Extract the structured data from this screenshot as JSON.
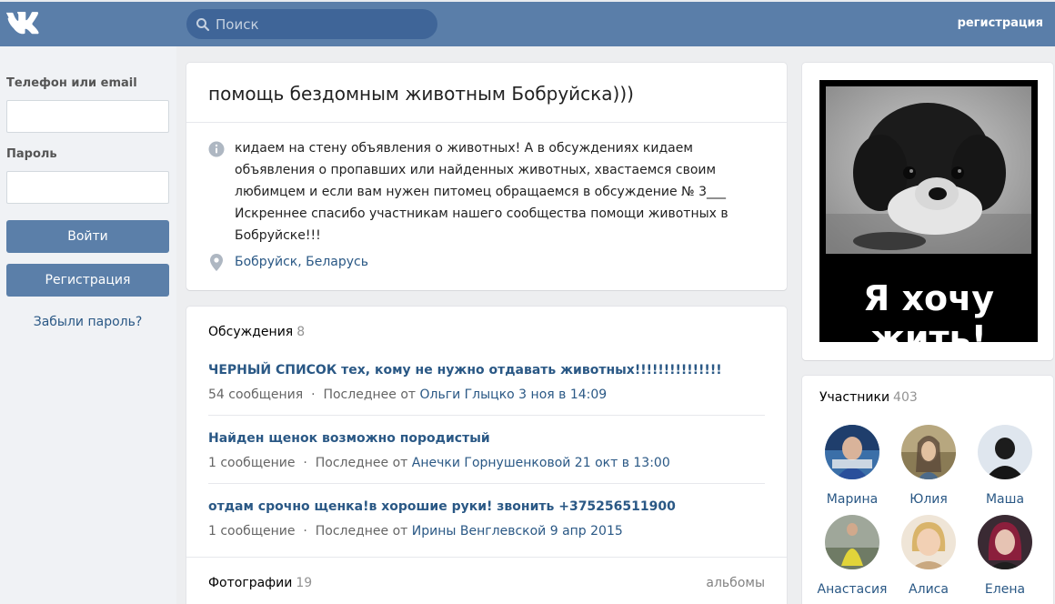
{
  "header": {
    "search_placeholder": "Поиск",
    "register_link": "регистрация",
    "colors": {
      "bar": "#5a7ea9",
      "search_bg": "#3f6598"
    }
  },
  "login": {
    "phone_label": "Телефон или email",
    "phone_value": "",
    "password_label": "Пароль",
    "password_value": "",
    "login_button": "Войти",
    "register_button": "Регистрация",
    "forgot_link": "Забыли пароль?"
  },
  "group": {
    "title": "помощь бездомным животным Бобруйска)))",
    "description": "кидаем на стену объявления о животных! А в обсуждениях кидаем объявления о пропавших или найденных животных, хвастаемся своим любимцем и если вам нужен питомец обращаемся в обсуждение № 3___ Искреннее спасибо участникам нашего сообщества помощи животных в Бобруйске!!!",
    "location": "Бобруйск, Беларусь"
  },
  "discussions": {
    "title": "Обсуждения",
    "count": "8",
    "topics": [
      {
        "title": "ЧЕРНЫЙ СПИСОК тех, кому не нужно отдавать животных!!!!!!!!!!!!!!!",
        "posts": "54 сообщения",
        "sep": "·",
        "last_prefix": "Последнее от",
        "last_author_date": "Ольги Глыцко 3 ноя в 14:09"
      },
      {
        "title": "Найден щенок возможно породистый",
        "posts": "1 сообщение",
        "sep": "·",
        "last_prefix": "Последнее от",
        "last_author_date": "Анечки Горнушенковой 21 окт в 13:00"
      },
      {
        "title": "отдам срочно щенка!в хорошие руки! звонить +375256511900",
        "posts": "1 сообщение",
        "sep": "·",
        "last_prefix": "Последнее от",
        "last_author_date": "Ирины Венглевской 9 апр 2015"
      }
    ]
  },
  "photos": {
    "title": "Фотографии",
    "count": "19",
    "albums_link": "альбомы"
  },
  "poster": {
    "caption": "Я хочу жить!"
  },
  "members": {
    "title": "Участники",
    "count": "403",
    "items": [
      {
        "name": "Марина"
      },
      {
        "name": "Юлия"
      },
      {
        "name": "Маша"
      },
      {
        "name": "Анастасия"
      },
      {
        "name": "Алиса"
      },
      {
        "name": "Елена"
      }
    ]
  }
}
